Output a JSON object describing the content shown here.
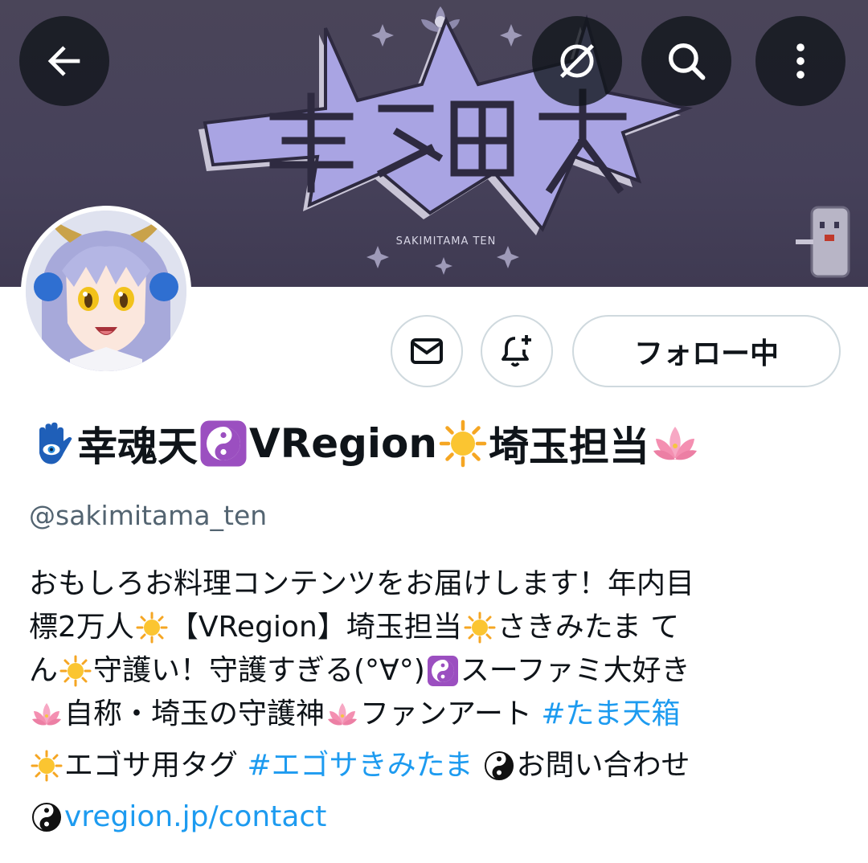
{
  "banner": {
    "logo_subtitle": "SAKIMITAMA TEN",
    "icons": {
      "back": "arrow-left-icon",
      "translate": "translate-globe-icon",
      "search": "search-icon",
      "more": "more-vertical-icon"
    }
  },
  "actions": {
    "message_icon": "envelope-icon",
    "notify_icon": "bell-plus-icon",
    "follow_label": "フォロー中"
  },
  "profile": {
    "name_parts": [
      "幸魂天",
      "VRegion",
      "埼玉担当"
    ],
    "name_emojis": [
      "hamsa-emoji",
      "yin-yang-emoji",
      "sun-emoji",
      "lotus-emoji"
    ],
    "handle": "@sakimitama_ten"
  },
  "bio": {
    "l1": "おもしろお料理コンテンツをお届けします！年内目",
    "l2a": "標2万人",
    "l2b": "【VRegion】埼玉担当",
    "l2c": "さきみたま て",
    "l3a": "ん",
    "l3b": "守護い！守護すぎる(°∀°)",
    "l3c": "スーファミ大好き",
    "l4a": "自称・埼玉の守護神",
    "l4b": "ファンアート ",
    "hashtag1": "#たま天箱",
    "l5a": "エゴサ用タグ ",
    "hashtag2": "#エゴサきみたま",
    "l5b": "お問い合わせ",
    "link": "vregion.jp/contact"
  },
  "colors": {
    "banner": "#46415a",
    "logo_purple": "#a9a4e3",
    "link_blue": "#1d9bf0",
    "handle_gray": "#536471",
    "border_gray": "#cfd9de"
  }
}
